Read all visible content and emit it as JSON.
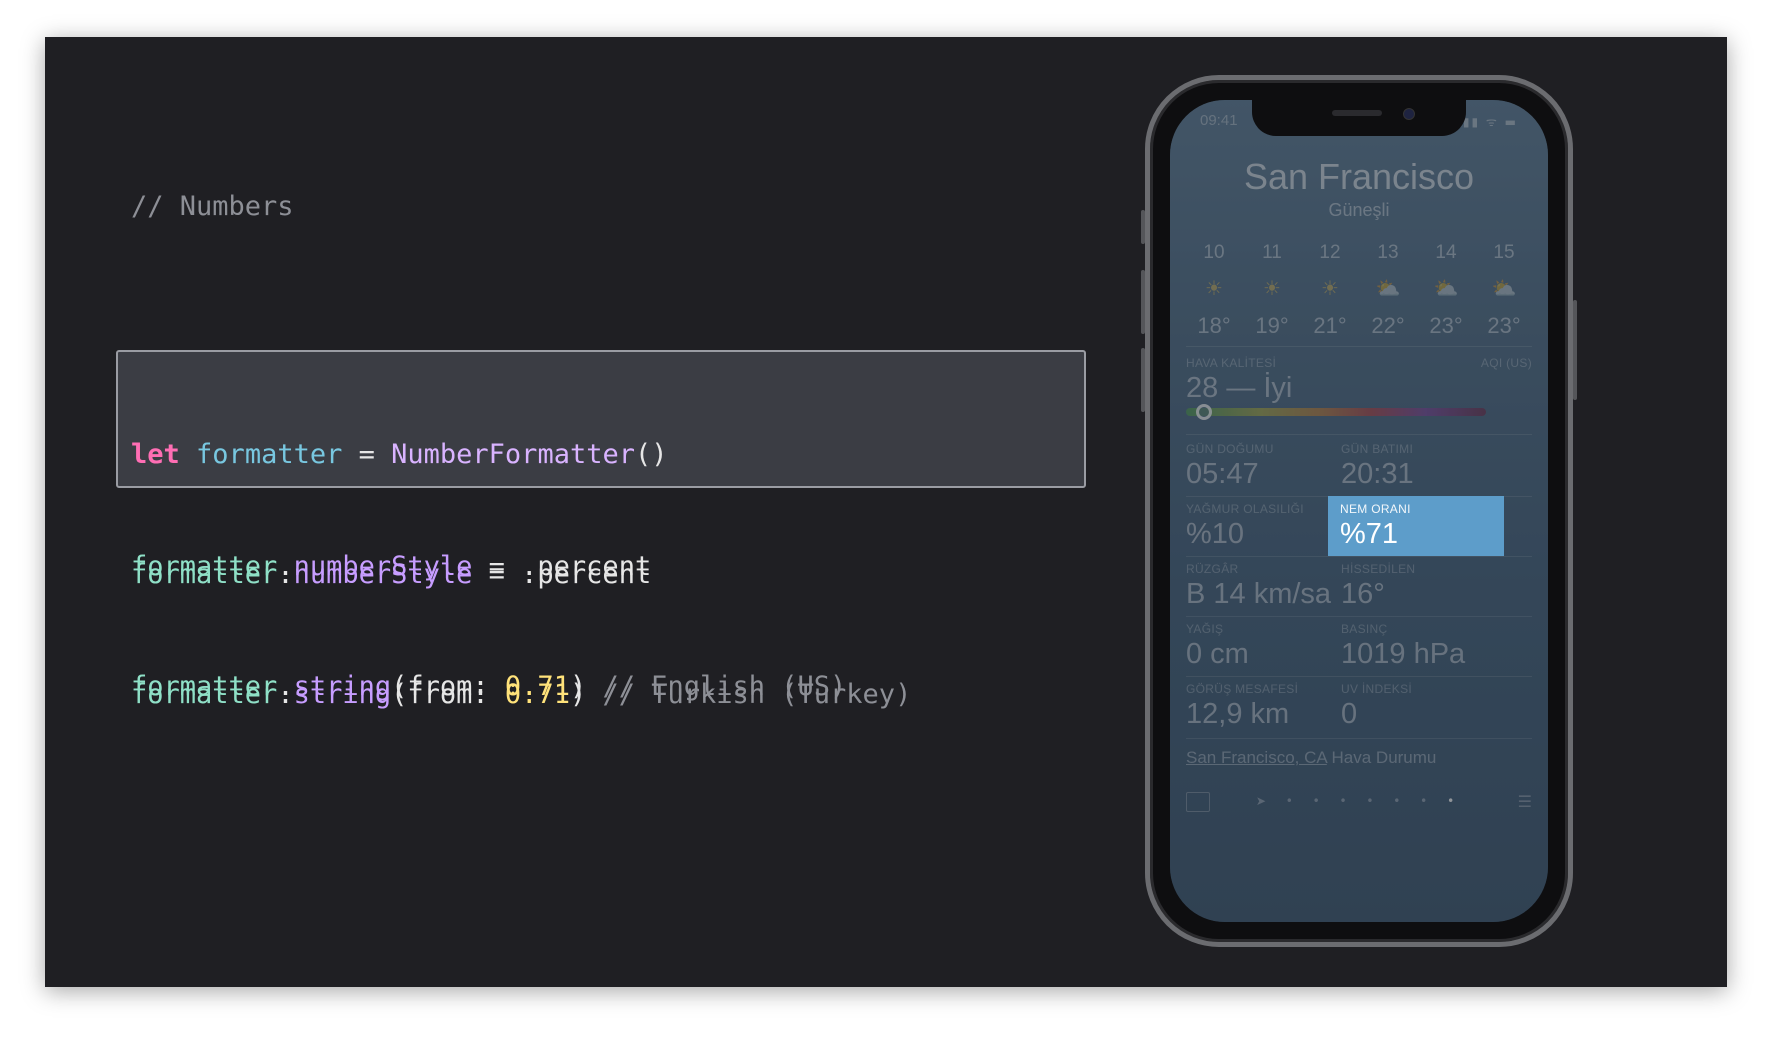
{
  "code": {
    "heading_comment": "// Numbers",
    "block1": {
      "kw": "let",
      "var": "formatter",
      "eq": " = ",
      "type": "NumberFormatter",
      "parens": "()",
      "l2_obj": "formatter",
      "l2_dot": ".",
      "l2_prop": "numberStyle",
      "l2_rest": " = .percent",
      "l3_obj": "formatter",
      "l3_dot": ".",
      "l3_fn": "string",
      "l3_open": "(from: ",
      "l3_num": "0.71",
      "l3_close": ") ",
      "l3_comment": "// English (US)"
    },
    "block2": {
      "kw": "let",
      "var": "formatter",
      "eq": " = ",
      "type": "NumberFormatter",
      "parens": "()",
      "l2_obj": "formatter",
      "l2_dot": ".",
      "l2_prop": "numberStyle",
      "l2_rest": " = .percent",
      "l3_obj": "formatter",
      "l3_dot": ".",
      "l3_fn": "string",
      "l3_open": "(from: ",
      "l3_num": "0.71",
      "l3_close": ") ",
      "l3_comment": "// Turkish (Turkey)"
    }
  },
  "phone": {
    "status_time": "09:41",
    "status_icons": "▮▮ ᯤ ▬",
    "city": "San Francisco",
    "condition": "Güneşli",
    "hours": [
      {
        "hour": "10",
        "icon": "sun-icon",
        "glyph": "☀",
        "temp": "18°"
      },
      {
        "hour": "11",
        "icon": "sun-icon",
        "glyph": "☀",
        "temp": "19°"
      },
      {
        "hour": "12",
        "icon": "sun-icon",
        "glyph": "☀",
        "temp": "21°"
      },
      {
        "hour": "13",
        "icon": "partly-cloudy-icon",
        "glyph": "⛅",
        "temp": "22°"
      },
      {
        "hour": "14",
        "icon": "partly-cloudy-icon",
        "glyph": "⛅",
        "temp": "23°"
      },
      {
        "hour": "15",
        "icon": "partly-cloudy-icon",
        "glyph": "⛅",
        "temp": "23°"
      }
    ],
    "aqi": {
      "label": "HAVA KALİTESİ",
      "unit": "AQI (US)",
      "value": "28 — İyi",
      "level": 0.06
    },
    "details": [
      {
        "label": "GÜN DOĞUMU",
        "value": "05:47"
      },
      {
        "label": "GÜN BATIMI",
        "value": "20:31"
      },
      {
        "label": "YAĞMUR OLASILIĞI",
        "value": "%10"
      },
      {
        "label": "NEM ORANI",
        "value": "%71"
      },
      {
        "label": "RÜZGÂR",
        "value": "B 14 km/sa"
      },
      {
        "label": "HİSSEDİLEN",
        "value": "16°"
      },
      {
        "label": "YAĞIŞ",
        "value": "0 cm"
      },
      {
        "label": "BASINÇ",
        "value": "1019 hPa"
      },
      {
        "label": "GÖRÜŞ MESAFESİ",
        "value": "12,9 km"
      },
      {
        "label": "UV İNDEKSİ",
        "value": "0"
      }
    ],
    "footer": {
      "link": "San Francisco, CA",
      "text": " Hava Durumu"
    },
    "pager": {
      "location_glyph": "➤",
      "dots": "• • • • • • ",
      "active_dot": "•",
      "list_glyph": "☰"
    },
    "highlight_color": "#5d9dca"
  }
}
